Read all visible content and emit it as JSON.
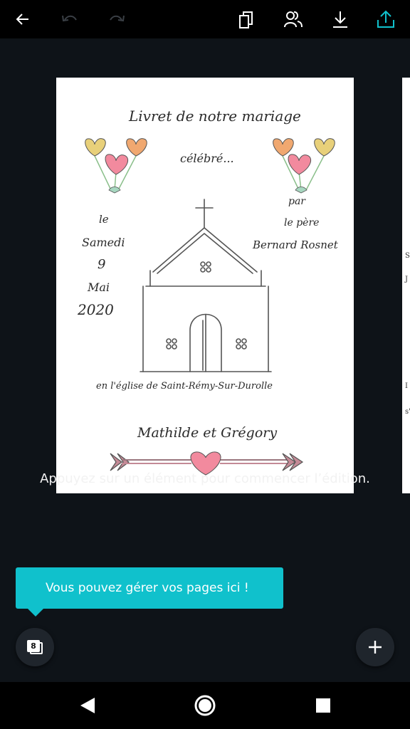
{
  "toolbar": {
    "back_icon": "arrow-left-icon",
    "undo_icon": "undo-icon",
    "redo_icon": "redo-icon",
    "copy_icon": "duplicate-icon",
    "collab_icon": "people-icon",
    "download_icon": "download-icon",
    "share_icon": "upload-share-icon",
    "share_color": "#10c1cc"
  },
  "design": {
    "title": "Livret de notre mariage",
    "subtitle": "célébré...",
    "date_le": "le",
    "date_day": "Samedi",
    "date_num": "9",
    "date_month": "Mai",
    "date_year": "2020",
    "par": "par",
    "pere": "le père",
    "priest": "Bernard Rosnet",
    "church": "en l'église de Saint-Rémy-Sur-Durolle",
    "couple": "Mathilde et Grégory"
  },
  "hint": "Appuyez sur un élément pour commencer l’édition.",
  "tooltip": "Vous pouvez gérer vos pages ici !",
  "pages": {
    "count": "8"
  },
  "fab_add_icon": "plus-icon",
  "system_nav": {
    "back": "nav-back-icon",
    "home": "nav-home-icon",
    "recents": "nav-recents-icon"
  }
}
